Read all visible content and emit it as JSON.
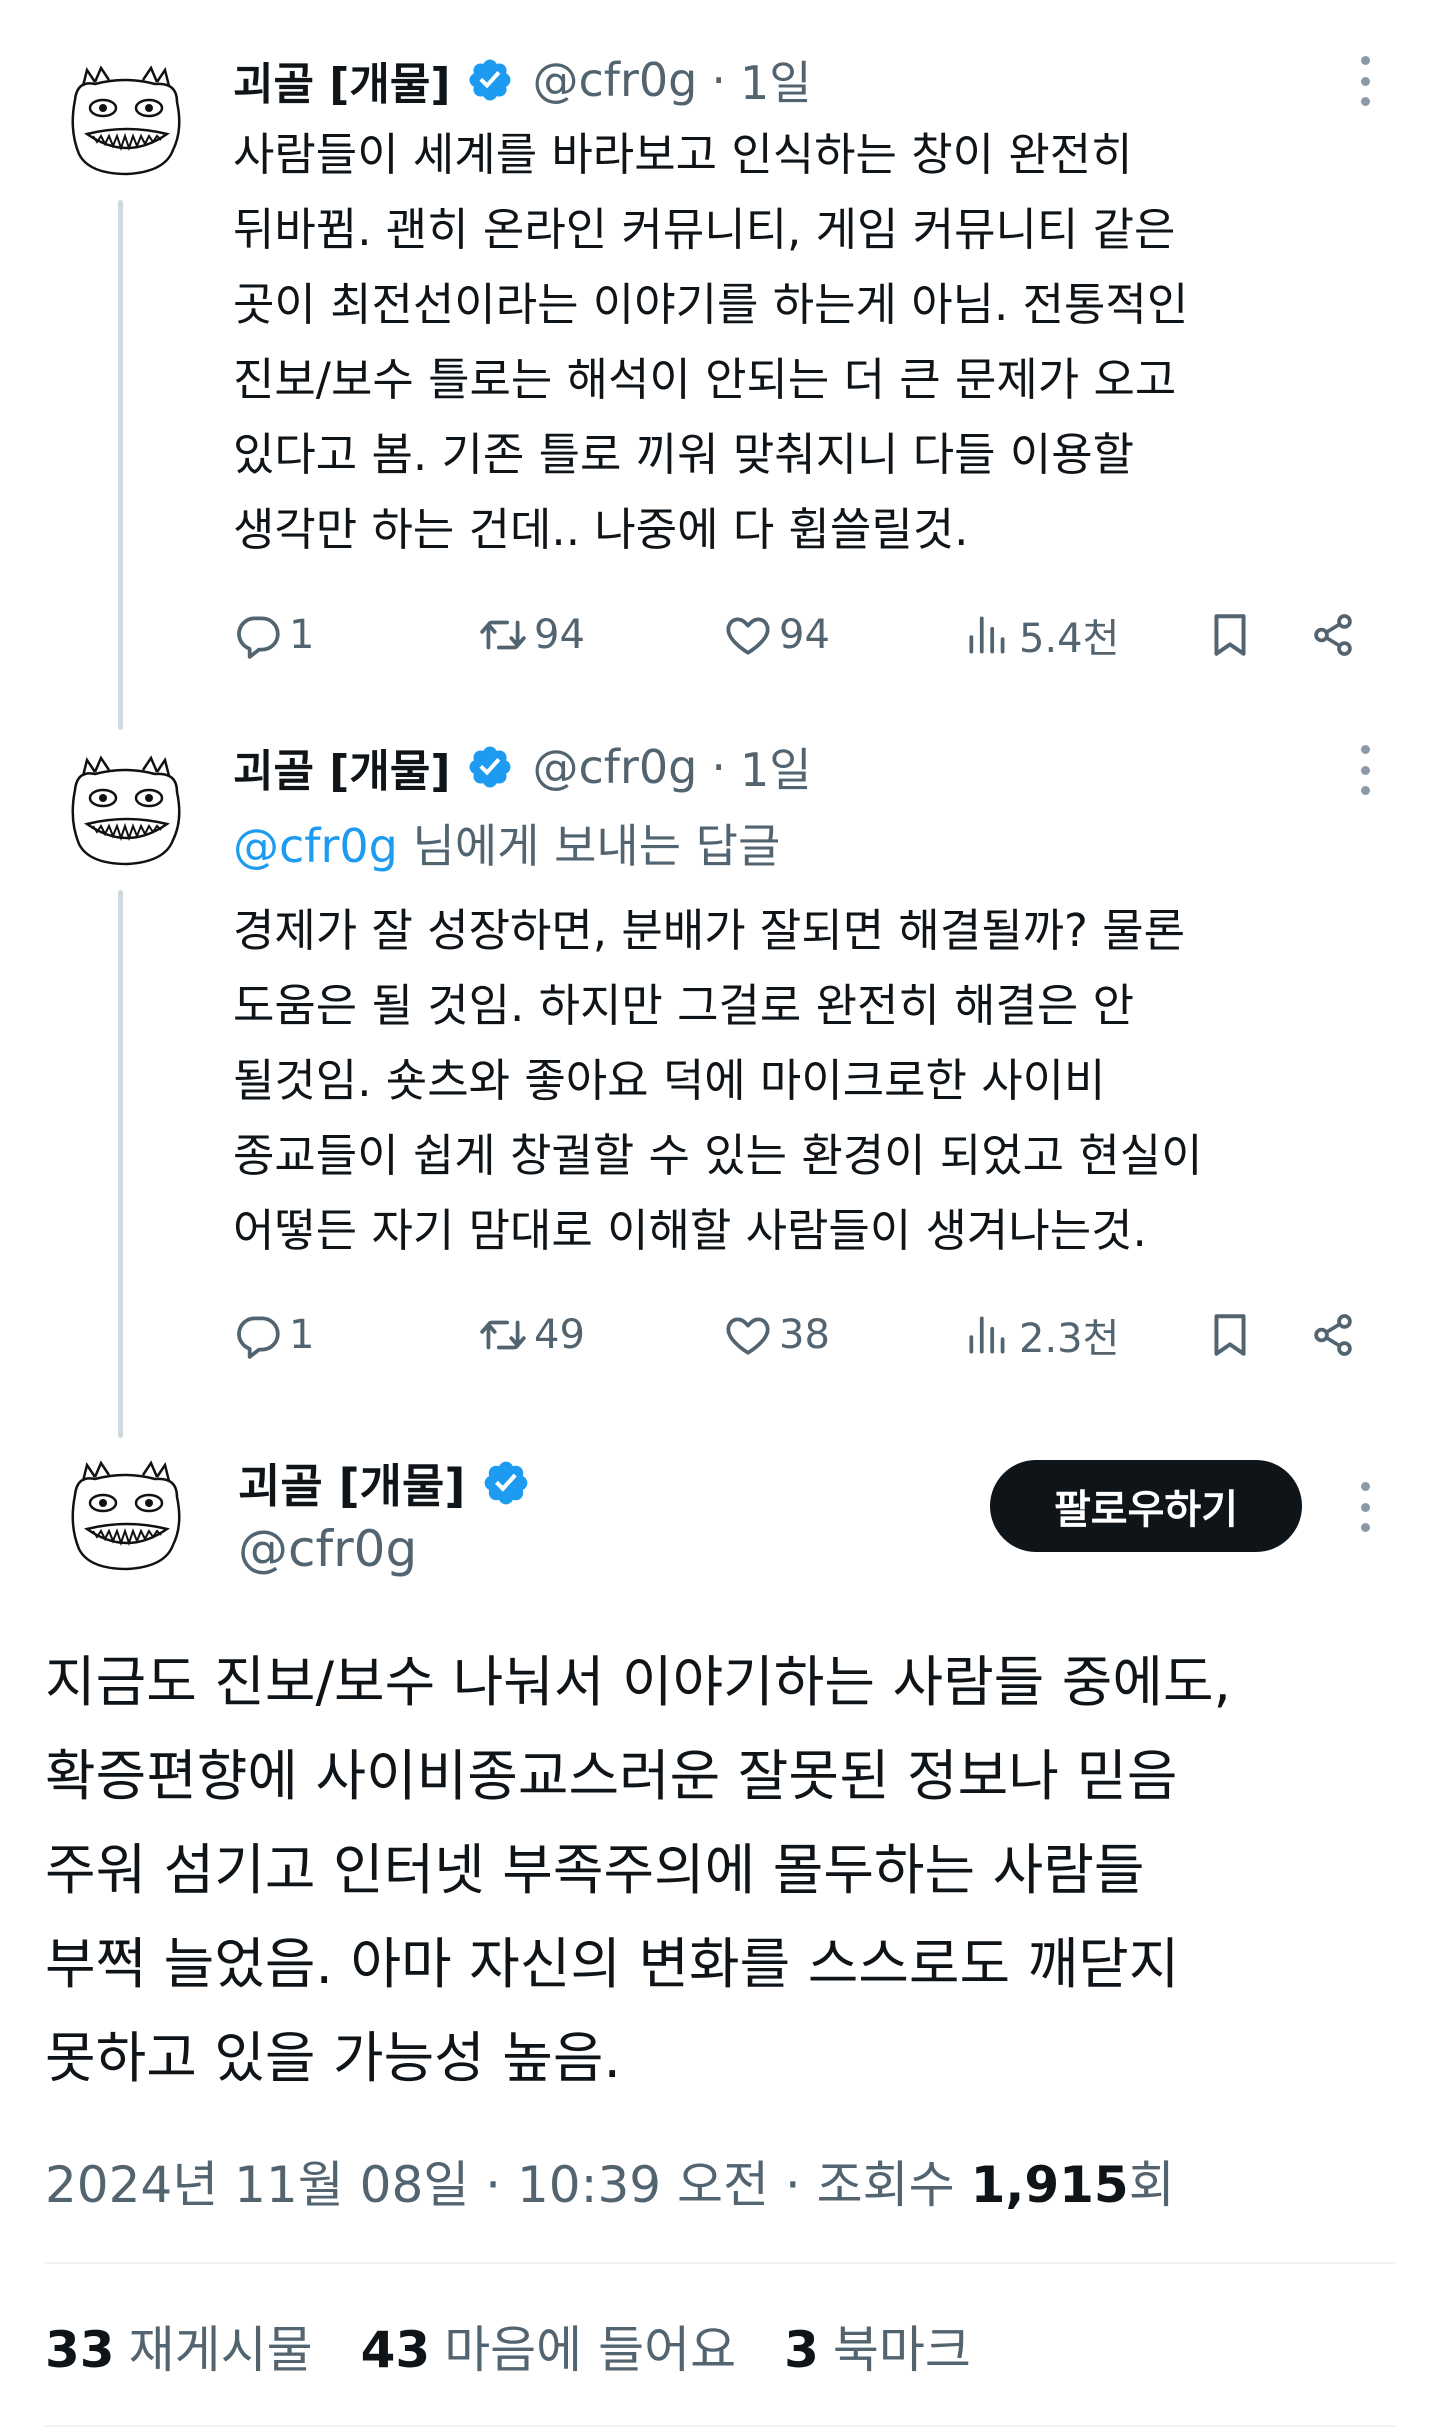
{
  "thread": [
    {
      "author": {
        "name": "괴골 [개물]",
        "handle": "@cfr0g",
        "verified": true
      },
      "time": "1일",
      "separator": "·",
      "reply_to": null,
      "text": "사람들이 세계를 바라보고 인식하는 창이 완전히\n뒤바뀜. 괜히 온라인 커뮤니티, 게임 커뮤니티 같은\n곳이 최전선이라는 이야기를 하는게 아님. 전통적인\n진보/보수 틀로는 해석이 안되는 더 큰 문제가 오고\n있다고 봄. 기존 틀로 끼워 맞춰지니 다들 이용할\n생각만 하는 건데.. 나중에 다 휩쓸릴것.",
      "stats": {
        "replies": "1",
        "reposts": "94",
        "likes": "94",
        "views": "5.4천"
      }
    },
    {
      "author": {
        "name": "괴골 [개물]",
        "handle": "@cfr0g",
        "verified": true
      },
      "time": "1일",
      "separator": "·",
      "reply_to": {
        "mention": "@cfr0g",
        "suffix": " 님에게 보내는 답글"
      },
      "text": "경제가 잘 성장하면, 분배가 잘되면 해결될까? 물론\n도움은 될 것임. 하지만 그걸로 완전히 해결은 안\n될것임. 숏츠와 좋아요 덕에 마이크로한 사이비\n종교들이 쉽게 창궐할 수 있는 환경이 되었고 현실이\n어떻든 자기 맘대로 이해할 사람들이 생겨나는것.",
      "stats": {
        "replies": "1",
        "reposts": "49",
        "likes": "38",
        "views": "2.3천"
      }
    }
  ],
  "main_tweet": {
    "author": {
      "name": "괴골 [개물]",
      "handle": "@cfr0g",
      "verified": true
    },
    "follow_label": "팔로우하기",
    "text": "지금도 진보/보수 나눠서 이야기하는 사람들 중에도,\n확증편향에 사이비종교스러운 잘못된 정보나 믿음\n주워 섬기고 인터넷 부족주의에 몰두하는 사람들\n부쩍 늘었음. 아마 자신의 변화를 스스로도 깨닫지\n못하고 있을 가능성 높음.",
    "meta": {
      "date": "2024년 11월 08일",
      "sep1": " · ",
      "time": "10:39 오전",
      "sep2": " · ",
      "views_label": "조회수 ",
      "views_count": "1,915",
      "views_suffix": "회"
    },
    "engagement": [
      {
        "count": "33",
        "label": "재게시물"
      },
      {
        "count": "43",
        "label": "마음에 들어요"
      },
      {
        "count": "3",
        "label": "북마크"
      }
    ]
  },
  "colors": {
    "text": "#0f1419",
    "secondary": "#536471",
    "verified": "#1d9bf0",
    "mention": "#1d9bf0",
    "follow_bg": "#0f1419",
    "divider": "#eff3f4",
    "thread_line": "#cfd9de"
  },
  "icons": [
    "avatar-doodle",
    "verified-badge-icon",
    "more-icon",
    "reply-icon",
    "repost-icon",
    "like-icon",
    "views-icon",
    "bookmark-icon",
    "share-icon"
  ]
}
